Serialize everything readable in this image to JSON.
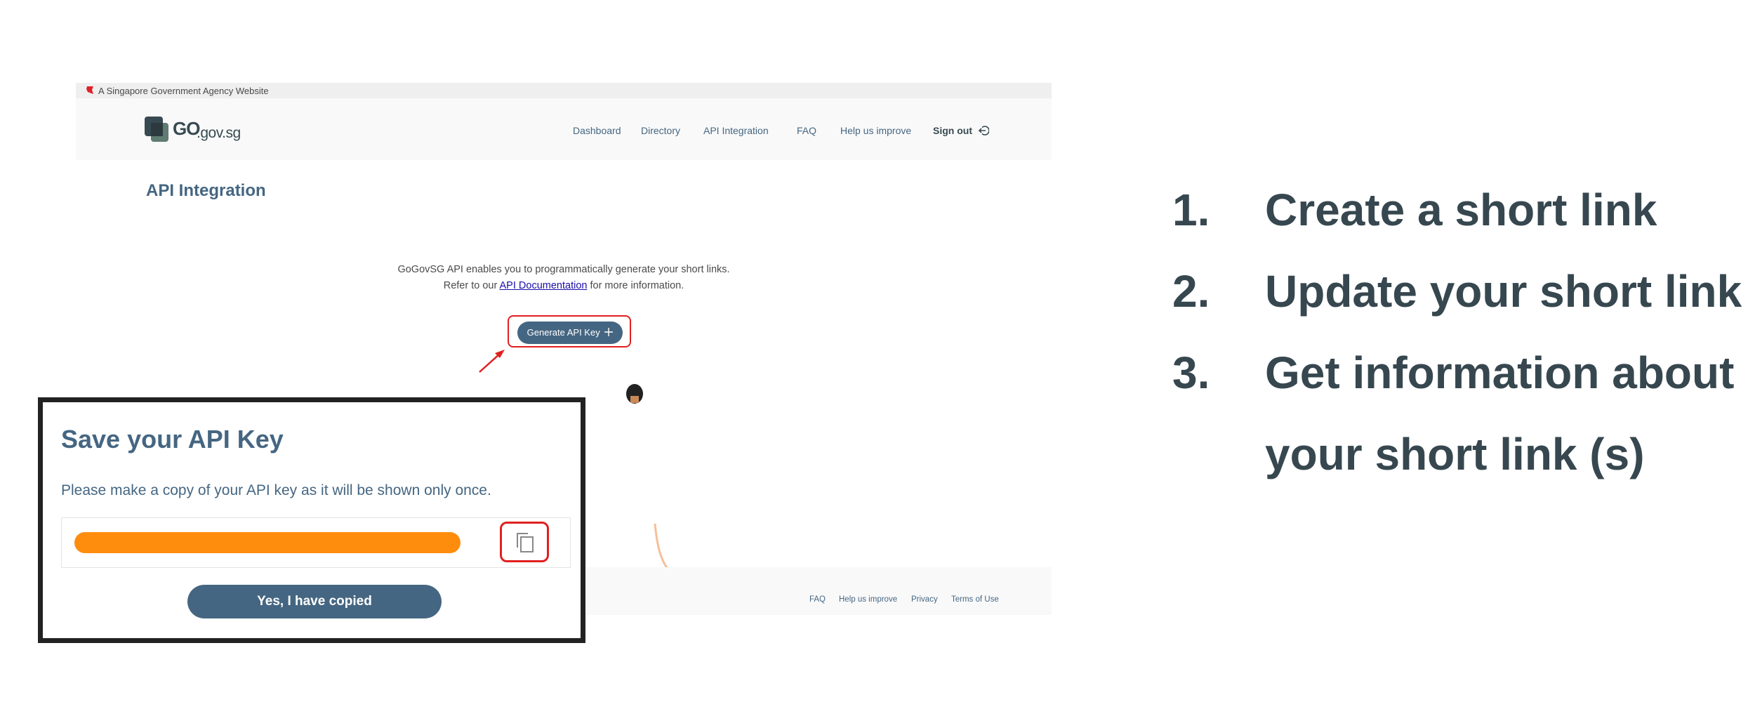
{
  "masthead": {
    "text": "A Singapore Government Agency Website"
  },
  "logo": {
    "primary": "GO",
    "secondary": ".gov.sg"
  },
  "nav": {
    "items": [
      "Dashboard",
      "Directory",
      "API Integration",
      "FAQ",
      "Help us improve"
    ],
    "signout": "Sign out",
    "signout_icon": "sign-out-icon"
  },
  "page": {
    "title": "API Integration",
    "intro_line1": "GoGovSG API enables you to programmatically generate your short links.",
    "intro_prefix": "Refer to our ",
    "intro_link": "API Documentation",
    "intro_suffix": " for more information.",
    "generate_button": "Generate API Key",
    "generate_icon": "plus-icon"
  },
  "footer": {
    "links": [
      "FAQ",
      "Help us improve",
      "Privacy",
      "Terms of Use"
    ]
  },
  "modal": {
    "title": "Save your API Key",
    "description": "Please make a copy of your API key as it will be shown only once.",
    "copy_icon": "copy-icon",
    "confirm_button": "Yes, I have copied"
  },
  "steps": [
    {
      "number": "1.",
      "text": "Create a short link"
    },
    {
      "number": "2.",
      "text": "Update your short link"
    },
    {
      "number": "3.",
      "text": "Get information about"
    },
    {
      "number": "",
      "text": "your short link (s)"
    }
  ],
  "colors": {
    "primary": "#456682",
    "highlight": "#e02020",
    "key_bar": "#fe8d0e",
    "steps_text": "#37474f"
  }
}
